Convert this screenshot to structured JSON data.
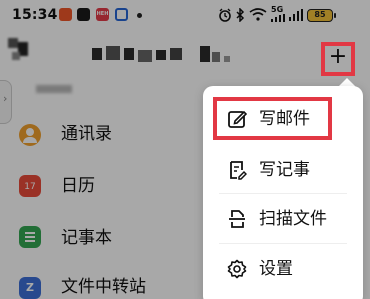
{
  "status_bar": {
    "time": "15:34",
    "battery": "85",
    "icons": [
      "alarm-icon",
      "bluetooth-icon",
      "wifi-icon",
      "signal-5g-icon",
      "signal-icon",
      "battery-icon"
    ],
    "network_label": "5G"
  },
  "header": {
    "add_icon": "plus-icon"
  },
  "app_list": [
    {
      "label": "通讯录",
      "icon": "contacts-icon"
    },
    {
      "label": "日历",
      "icon": "calendar-icon",
      "badge": "17"
    },
    {
      "label": "记事本",
      "icon": "notes-icon"
    },
    {
      "label": "文件中转站",
      "icon": "file-transfer-icon",
      "badge": "Z"
    }
  ],
  "popup_menu": {
    "items": [
      {
        "label": "写邮件",
        "icon": "compose-icon",
        "highlighted": true
      },
      {
        "label": "写记事",
        "icon": "note-edit-icon"
      },
      {
        "label": "扫描文件",
        "icon": "scan-icon"
      },
      {
        "label": "设置",
        "icon": "settings-icon"
      }
    ]
  },
  "colors": {
    "highlight_border": "#e23844",
    "dim_overlay": "rgba(0,0,0,0.34)",
    "contacts": "#f2a12e",
    "calendar": "#ea4b3a",
    "notes": "#35a853",
    "transfer": "#3d6fd8"
  }
}
